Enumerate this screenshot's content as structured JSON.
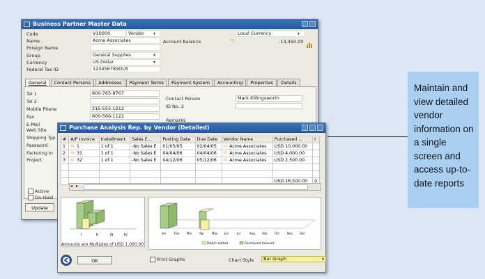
{
  "bp_window": {
    "title": "Business Partner Master Data",
    "labels": [
      "Code",
      "Name",
      "Foreign Name",
      "Group",
      "Currency",
      "Federal Tax ID"
    ],
    "values": {
      "code": "V10000",
      "type": "Vendor",
      "name": "Acme Associates",
      "foreign_name": "",
      "group": "General Supplies",
      "currency": "US Dollar",
      "tax_id": "123456789OUS"
    },
    "account_balance_label": "Account Balance",
    "local_currency": "Local Currency",
    "balance": "-13,450.00",
    "tabs": [
      "General",
      "Contact Persons",
      "Addresses",
      "Payment Terms",
      "Payment System",
      "Accounting",
      "Properties",
      "Details"
    ],
    "general_labels": [
      "Tel 1",
      "Tel 2",
      "Mobile Phone",
      "Fax",
      "E-Mail",
      "Web Site",
      "Shipping Typ",
      "Password",
      "Factoring In",
      "Project"
    ],
    "general_values": {
      "tel1": "800-765-8767",
      "tel2": "",
      "mobile": "215-555-1212",
      "fax": "800-566-1122"
    },
    "contact_person_label": "Contact Person",
    "contact_person": "Mark Killingsworth",
    "id_no_label": "ID No. 2",
    "remarks_label": "Remarks",
    "active_label": "Active",
    "on_hold_label": "On Hold",
    "update_button": "Update"
  },
  "report_window": {
    "title": "Purchase Analysis Rep. by Vendor (Detailed)",
    "columns": [
      "#",
      "A/P Invoice",
      "Installment",
      "Sales E...",
      "Posting Date",
      "Due Date",
      "Vendor Name",
      "Purchased ...",
      "I"
    ],
    "rows": [
      {
        "n": "1",
        "inv": "1",
        "inst": "1 of 1",
        "sales": "-No Sales E",
        "post": "01/05/05",
        "due": "02/04/05",
        "vendor": "Acme Associates",
        "amt": "USD 10,000.00"
      },
      {
        "n": "2",
        "inv": "31",
        "inst": "1 of 1",
        "sales": "-No Sales E",
        "post": "04/04/06",
        "due": "04/04/06",
        "vendor": "Acme Associates",
        "amt": "USD 4,000.00"
      },
      {
        "n": "3",
        "inv": "32",
        "inst": "1 of 1",
        "sales": "-No Sales E",
        "post": "04/12/06",
        "due": "05/12/06",
        "vendor": "Acme Associates",
        "amt": "USD 2,500.00"
      }
    ],
    "total": "USD 16,500.00",
    "total_suffix": "0",
    "quarters": [
      "I",
      "II",
      "III",
      "IV"
    ],
    "months": [
      "Jan",
      "Feb",
      "Mar",
      "Apr",
      "May",
      "Jun",
      "Jul",
      "Aug",
      "Sep",
      "Oct",
      "Nov",
      "Dec"
    ],
    "legend_paid": "Paid/Credited",
    "legend_purchased": "Purchased Amount",
    "multiples_note": "Amounts are Multiples of USD 1,000.00",
    "ok_button": "OK",
    "print_graphs": "Print Graphs",
    "chart_style_label": "Chart Style",
    "chart_style_value": "Bar Graph"
  },
  "callout": "Maintain and view detailed vendor information on a single screen and access up-to-date reports",
  "colors": {
    "title_bar": "#21589e",
    "callout": "#a9cff2",
    "bar_green": "#a6cf86",
    "bar_yellow": "#f6f2a0",
    "arrow": "#e8a23a"
  }
}
